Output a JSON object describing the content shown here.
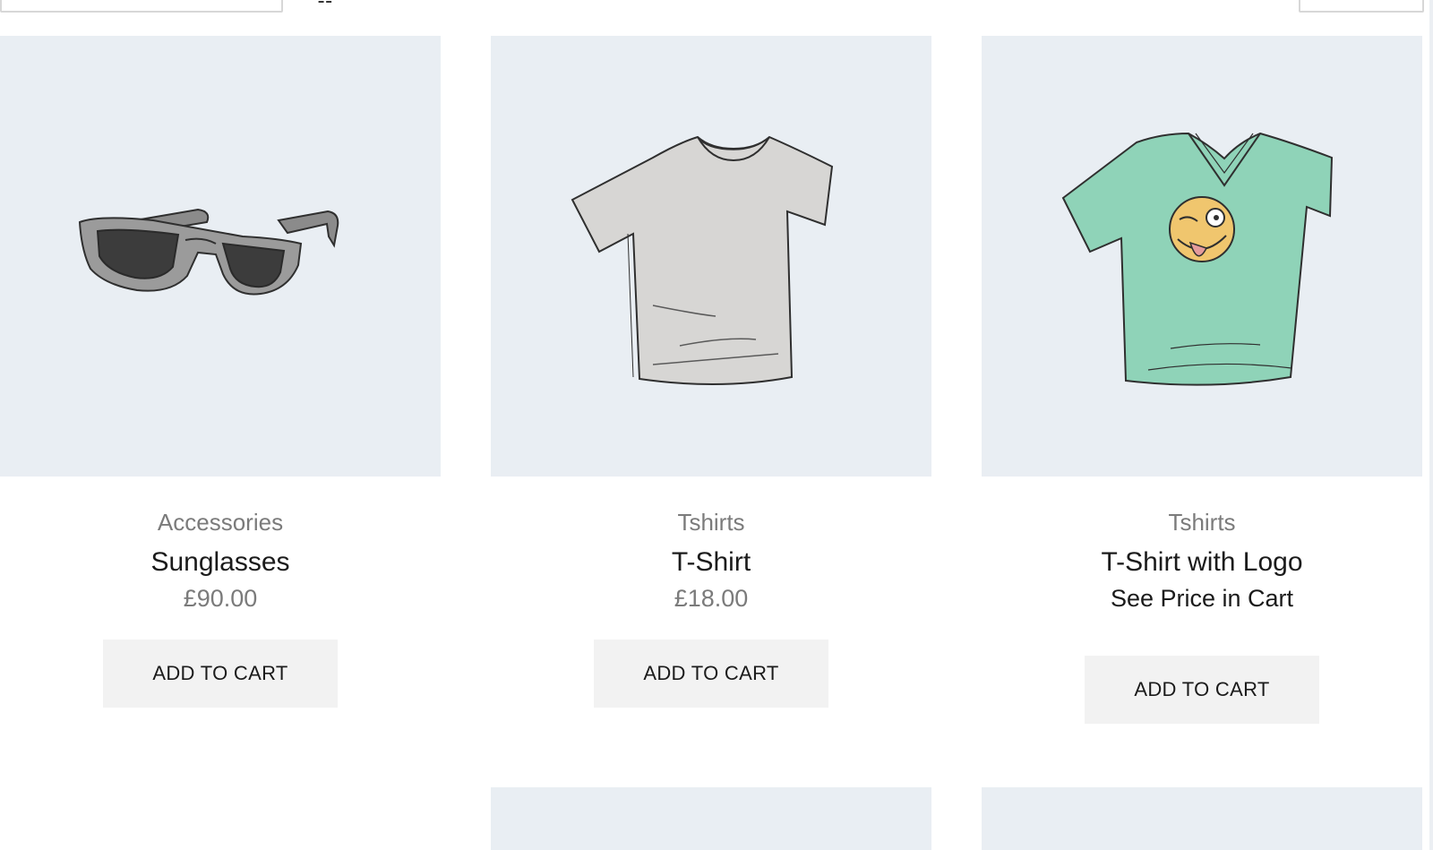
{
  "products": [
    {
      "category": "Accessories",
      "name": "Sunglasses",
      "price": "£90.00",
      "button": "ADD TO CART",
      "image_icon": "sunglasses-image"
    },
    {
      "category": "Tshirts",
      "name": "T-Shirt",
      "price": "£18.00",
      "button": "ADD TO CART",
      "image_icon": "tshirt-image"
    },
    {
      "category": "Tshirts",
      "name": "T-Shirt with Logo",
      "price": "See Price in Cart",
      "button": "ADD TO CART",
      "image_icon": "tshirt-with-logo-image"
    }
  ],
  "colors": {
    "thumb_bg": "#e9eef3",
    "button_bg": "#f2f2f2",
    "muted_text": "#7b7b7b",
    "dark_text": "#1b1b1b",
    "tshirt_grey": "#d7d6d4",
    "tshirt_green": "#8fd3b8",
    "emoji_yellow": "#f0c66e"
  }
}
